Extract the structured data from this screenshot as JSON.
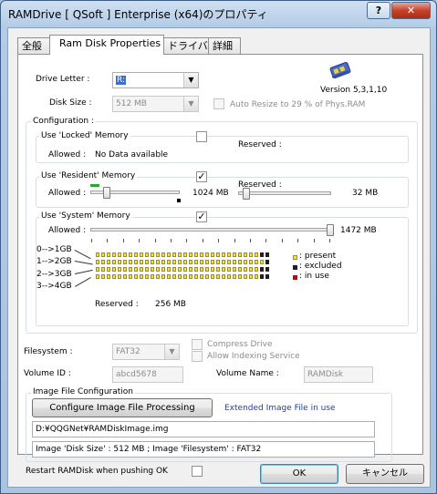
{
  "window": {
    "title": "RAMDrive [ QSoft ] Enterprise (x64)のプロパティ",
    "help_label": "?",
    "close_label": "✕"
  },
  "tabs": [
    "全般",
    "Ram Disk Properties",
    "ドライバ",
    "詳細"
  ],
  "drive": {
    "letter_label": "Drive Letter :",
    "letter_value": "R:",
    "size_label": "Disk Size :",
    "size_value": "512 MB",
    "auto_resize_label": "Auto Resize to 29 % of Phys.RAM",
    "version": "Version 5,3,1,10"
  },
  "configuration": {
    "title": "Configuration :",
    "locked": {
      "title": "Use 'Locked' Memory",
      "allowed_label": "Allowed :",
      "allowed_value": "No Data available",
      "reserved_label": "Reserved :",
      "checked": false
    },
    "resident": {
      "title": "Use 'Resident' Memory",
      "allowed_label": "Allowed :",
      "allowed_value": "1024 MB",
      "reserved_label": "Reserved :",
      "reserved_value": "32 MB",
      "checked": true
    },
    "system": {
      "title": "Use 'System' Memory",
      "allowed_label": "Allowed :",
      "allowed_value": "1472 MB",
      "checked": true,
      "rows": [
        "0-->1GB",
        "1-->2GB",
        "2-->3GB",
        "3-->4GB"
      ],
      "reserved_label": "Reserved :",
      "reserved_value": "256 MB",
      "legend": [
        ": present",
        ": excluded",
        ": in use"
      ]
    }
  },
  "filesystem": {
    "label": "Filesystem :",
    "value": "FAT32",
    "compress_label": "Compress Drive",
    "indexing_label": "Allow Indexing Service",
    "volume_id_label": "Volume ID :",
    "volume_id_value": "abcd5678",
    "volume_name_label": "Volume Name :",
    "volume_name_value": "RAMDisk"
  },
  "image_file": {
    "title": "Image File Configuration",
    "configure_button": "Configure Image File Processing",
    "extended_text": "Extended Image File in use",
    "path": "D:¥QQGNet¥RAMDiskImage.img",
    "info": "Image 'Disk Size' : 512 MB ; Image 'Filesystem' : FAT32"
  },
  "restart_label": "Restart RAMDisk when pushing OK",
  "buttons": {
    "ok": "OK",
    "cancel": "キャンセル"
  },
  "colors": {
    "present": "#f0e040",
    "excluded": "#202020",
    "in_use": "#b01010",
    "link_blue": "#1a3fb0",
    "usage_green": "#2aa52a"
  }
}
